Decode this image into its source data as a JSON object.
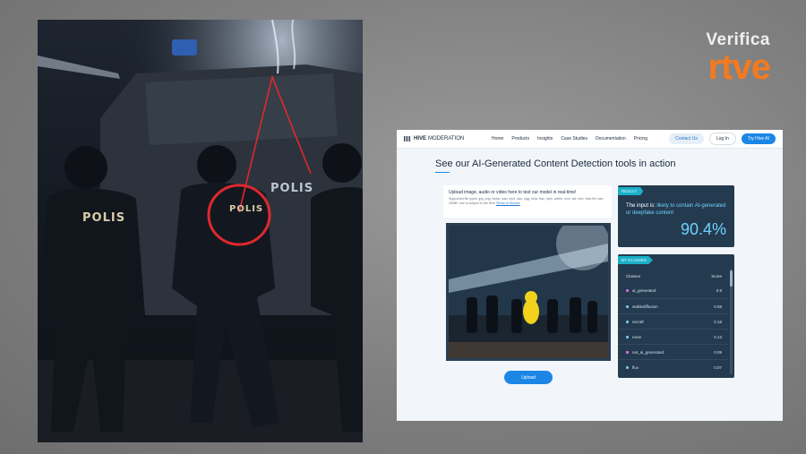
{
  "brand": {
    "top": "Verifica",
    "bottom": "rtve",
    "color": "#f47a20"
  },
  "photo": {
    "vest_labels": [
      "POLIS",
      "POLIS",
      "POLIS"
    ],
    "vehicle_label": "POLIS",
    "annotation_color": "#e0282d"
  },
  "hive": {
    "logo_bold": "HIVE",
    "logo_thin": "MODERATION",
    "nav_links": [
      "Home",
      "Products",
      "Insights",
      "Case Studies",
      "Documentation",
      "Pricing"
    ],
    "contact_label": "Contact Us",
    "login_label": "Log In",
    "try_label": "Try Hive AI",
    "headline": "See our AI-Generated Content Detection tools in action",
    "upload_title": "Upload image, audio or video here to test our model in real-time!",
    "upload_sub": "Supported file types: jpg, png, webp, wav, mp3, aac, ogg, m4a, flac, mp4, webm, mov, avi, mkv. Max file size: 20MB. Use is subject to the Hive",
    "upload_link": "Terms of Service",
    "upload_button": "Upload",
    "result_tag": "RESULT",
    "verdict_prefix": "The input is:",
    "verdict_highlight": "likely to contain AI-generated or deepfake content",
    "score": "90.4%",
    "classes_tag": "BY CLASSES",
    "classes_col": "Classes",
    "score_col": "Score",
    "classes": [
      {
        "name": "ai_generated",
        "score": "0.9",
        "color": "#e26ae0"
      },
      {
        "name": "stablediffusion",
        "score": "0.58",
        "color": "#7fc4e8"
      },
      {
        "name": "recraft",
        "score": "0.18",
        "color": "#7fc4e8"
      },
      {
        "name": "none",
        "score": "0.13",
        "color": "#7fc4e8"
      },
      {
        "name": "not_ai_generated",
        "score": "0.09",
        "color": "#e26ae0"
      },
      {
        "name": "flux",
        "score": "0.07",
        "color": "#7fc4e8"
      }
    ]
  }
}
